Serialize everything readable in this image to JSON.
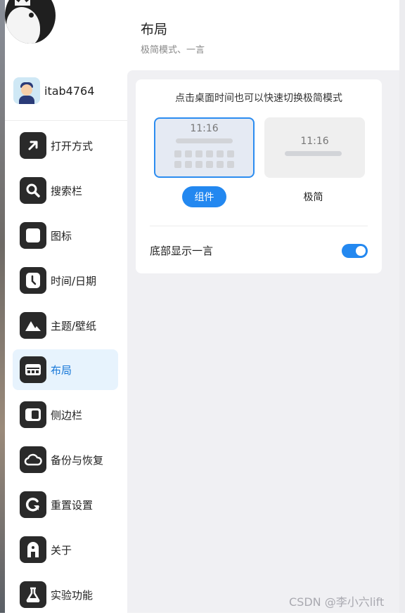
{
  "sidebar": {
    "username": "itab4764",
    "items": [
      {
        "label": "打开方式",
        "icon": "arrow-up-right-icon",
        "active": false
      },
      {
        "label": "搜索栏",
        "icon": "search-icon",
        "active": false
      },
      {
        "label": "图标",
        "icon": "square-icon",
        "active": false
      },
      {
        "label": "时间/日期",
        "icon": "clock-icon",
        "active": false
      },
      {
        "label": "主题/壁纸",
        "icon": "mountain-icon",
        "active": false
      },
      {
        "label": "布局",
        "icon": "layout-icon",
        "active": true
      },
      {
        "label": "侧边栏",
        "icon": "sidebar-icon",
        "active": false
      },
      {
        "label": "备份与恢复",
        "icon": "cloud-icon",
        "active": false
      },
      {
        "label": "重置设置",
        "icon": "reset-icon",
        "active": false
      },
      {
        "label": "关于",
        "icon": "about-icon",
        "active": false
      },
      {
        "label": "实验功能",
        "icon": "flask-icon",
        "active": false
      }
    ]
  },
  "header": {
    "title": "布局",
    "subtitle": "极简模式、一言"
  },
  "card": {
    "hint": "点击桌面时间也可以快速切换极简模式",
    "widget_preview_time": "11:16",
    "minimal_preview_time": "11:16",
    "mode_widget_label": "组件",
    "mode_minimal_label": "极简",
    "selected_mode": "组件",
    "hitokoto_label": "底部显示一言",
    "hitokoto_enabled": true
  },
  "colors": {
    "accent": "#2388f0",
    "active_nav_bg": "#e7f3fd",
    "panel_bg": "#f0f0f3"
  },
  "watermark": "CSDN @李小六lift"
}
